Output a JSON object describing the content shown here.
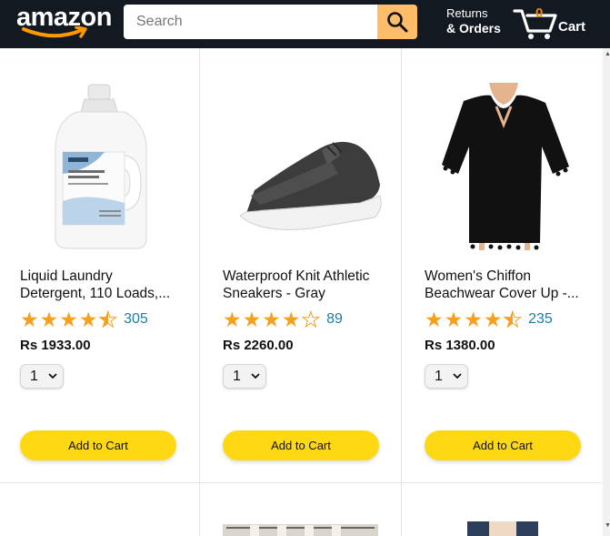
{
  "header": {
    "logo_text": "amazon",
    "search_placeholder": "Search",
    "returns_line1": "Returns",
    "returns_line2": "& Orders",
    "cart_count": "0",
    "cart_label": "Cart"
  },
  "products": [
    {
      "name_line1": "Liquid Laundry",
      "name_line2": "Detergent, 110 Loads,...",
      "rating": 4.5,
      "reviews": "305",
      "price": "Rs 1933.00",
      "qty": "1",
      "add_label": "Add to Cart"
    },
    {
      "name_line1": "Waterproof Knit Athletic",
      "name_line2": "Sneakers - Gray",
      "rating": 4.0,
      "reviews": "89",
      "price": "Rs 2260.00",
      "qty": "1",
      "add_label": "Add to Cart"
    },
    {
      "name_line1": "Women's Chiffon",
      "name_line2": "Beachwear Cover Up -...",
      "rating": 4.5,
      "reviews": "235",
      "price": "Rs 1380.00",
      "qty": "1",
      "add_label": "Add to Cart"
    }
  ],
  "colors": {
    "header_bg": "#131921",
    "search_button": "#febd69",
    "cart_count": "#f08804",
    "add_button": "#ffd814",
    "star": "#f7a01e",
    "review_link": "#1a7fa6"
  }
}
